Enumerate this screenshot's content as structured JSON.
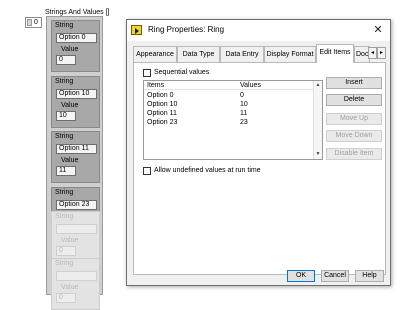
{
  "array": {
    "title": "Strings And Values []",
    "index": "0",
    "string_label": "String",
    "value_label": "Value",
    "elements": [
      {
        "string": "Option 0",
        "value": "0"
      },
      {
        "string": "Option 10",
        "value": "10"
      },
      {
        "string": "Option 11",
        "value": "11"
      },
      {
        "string": "Option 23",
        "value": "23"
      },
      {
        "string": "",
        "value": "0"
      },
      {
        "string": "",
        "value": "0"
      }
    ]
  },
  "dialog": {
    "title": "Ring Properties: Ring",
    "close_label": "✕",
    "tabs": [
      "Appearance",
      "Data Type",
      "Data Entry",
      "Display Format",
      "Edit Items",
      "Docu"
    ],
    "active_tab": "Edit Items",
    "tab_prev": "◂",
    "tab_next": "▸",
    "sequential_label": "Sequential values",
    "table": {
      "headers": [
        "Items",
        "Values"
      ],
      "rows": [
        [
          "Option 0",
          "0"
        ],
        [
          "Option 10",
          "10"
        ],
        [
          "Option 11",
          "11"
        ],
        [
          "Option 23",
          "23"
        ]
      ]
    },
    "buttons": {
      "insert": "Insert",
      "delete": "Delete",
      "move_up": "Move Up",
      "move_down": "Move Down",
      "disable_item": "Disable Item"
    },
    "allow_undefined_label": "Allow undefined values at run time",
    "footer": {
      "ok": "OK",
      "cancel": "Cancel",
      "help": "Help"
    }
  }
}
